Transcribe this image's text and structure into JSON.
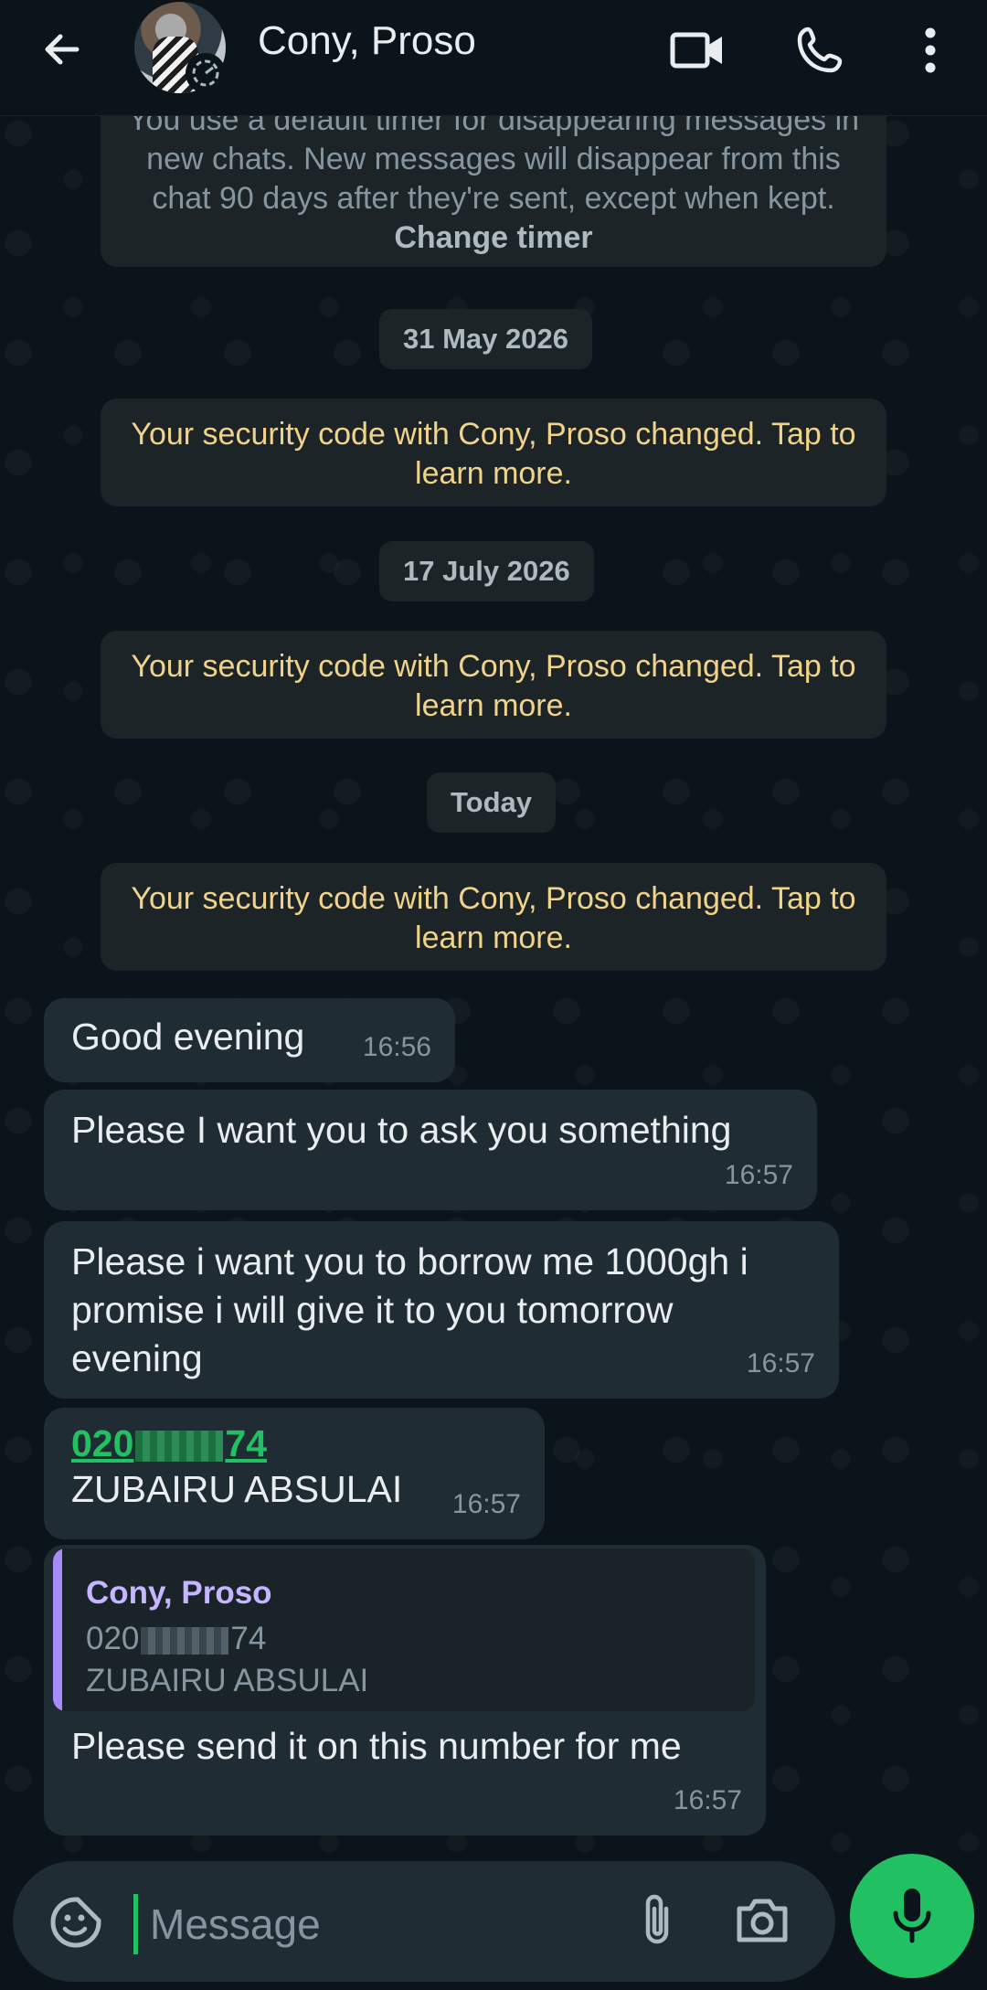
{
  "header": {
    "contact_name": "Cony, Proso"
  },
  "system": {
    "timer_notice": "You use a default timer for disappearing messages in new chats. New messages will disappear from this chat 90 days after they're sent, except when kept.",
    "change_timer_label": "Change timer",
    "security_notice": "Your security code with Cony, Proso changed. Tap to learn more."
  },
  "dates": [
    "31 May 2026",
    "17 July 2026",
    "Today"
  ],
  "messages": [
    {
      "text": "Good evening",
      "time": "16:56"
    },
    {
      "text": "Please I want you to ask you something",
      "time": "16:57"
    },
    {
      "text": "Please i want you to borrow me 1000gh i promise i will give it to you tomorrow evening",
      "time": "16:57"
    },
    {
      "phone_prefix": "020",
      "phone_suffix": "74",
      "name": "ZUBAIRU ABSULAI",
      "time": "16:57"
    },
    {
      "quote_author": "Cony, Proso",
      "quote_phone_prefix": "020",
      "quote_phone_suffix": "74",
      "quote_name": "ZUBAIRU ABSULAI",
      "text": "Please send it on this number for me",
      "time": "16:57"
    }
  ],
  "composer": {
    "placeholder": "Message"
  },
  "colors": {
    "accent": "#21c063",
    "bubble": "#202c33",
    "system_text": "#f1d48a",
    "quote_bar": "#a78bfa"
  }
}
